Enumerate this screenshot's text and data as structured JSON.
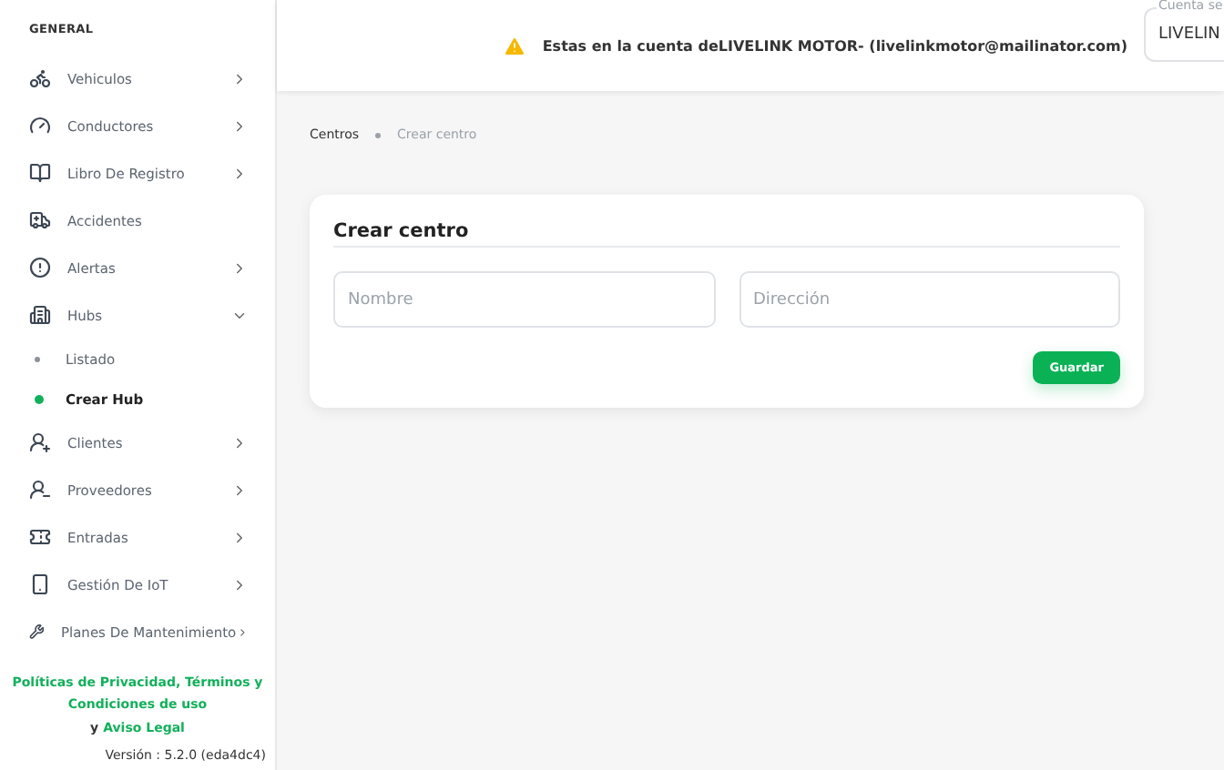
{
  "sidebar": {
    "section": "GENERAL",
    "items": [
      {
        "label": "Vehiculos",
        "expanded": false
      },
      {
        "label": "Conductores",
        "expanded": false
      },
      {
        "label": "Libro De Registro",
        "expanded": false
      },
      {
        "label": "Accidentes"
      },
      {
        "label": "Alertas",
        "expanded": false
      },
      {
        "label": "Hubs",
        "expanded": true,
        "children": [
          {
            "label": "Listado",
            "selected": false
          },
          {
            "label": "Crear Hub",
            "selected": true
          }
        ]
      },
      {
        "label": "Clientes",
        "expanded": false
      },
      {
        "label": "Proveedores",
        "expanded": false
      },
      {
        "label": "Entradas",
        "expanded": false
      },
      {
        "label": "Gestión De IoT",
        "expanded": false
      },
      {
        "label": "Planes De Mantenimiento",
        "expanded": false
      }
    ],
    "legal": [
      {
        "text": "Políticas de Privacidad, Términos y Condiciones de uso",
        "kind": "link"
      },
      {
        "text": "y",
        "kind": "text"
      },
      {
        "text": "Aviso Legal",
        "kind": "link"
      }
    ],
    "version": "Versión : 5.2.0 (eda4dc4)"
  },
  "header": {
    "notice": "Estas en la cuenta deLIVELINK MOTOR- (livelinkmotor@mailinator.com)",
    "account_field": {
      "label": "Cuenta se",
      "value": "LIVELIN"
    }
  },
  "breadcrumb": [
    {
      "label": "Centros",
      "current": false
    },
    {
      "label": "Crear centro",
      "current": true
    }
  ],
  "form": {
    "title": "Crear centro",
    "fields": [
      {
        "placeholder": "Nombre"
      },
      {
        "placeholder": "Dirección"
      }
    ],
    "submit": "Guardar"
  }
}
